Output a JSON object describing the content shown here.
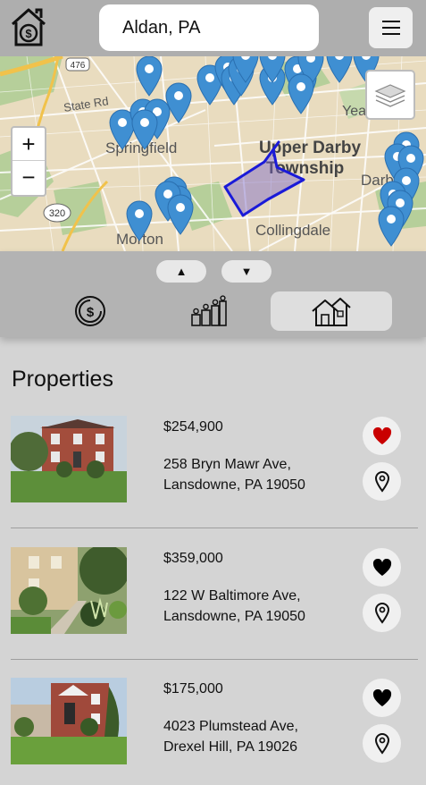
{
  "header": {
    "search_value": "Aldan, PA",
    "menu_icon": "hamburger-icon",
    "logo_icon": "house-dollar-icon"
  },
  "map": {
    "labels": {
      "road_476": "476",
      "state_rd": "State Rd",
      "springfield": "Springfield",
      "upper_darby": "Upper Darby",
      "township": "Township",
      "darby": "Darby",
      "yea": "Yea",
      "collingdale": "Collingdale",
      "morton": "Morton",
      "road_320": "320"
    },
    "zoom_in": "+",
    "zoom_out": "−",
    "layers_icon": "layers-icon",
    "marker_color": "#3f8fd2",
    "boundary_color": "#1a1ad8"
  },
  "panel": {
    "up_arrow": "▲",
    "down_arrow": "▼",
    "tabs": [
      {
        "icon": "dollar-circle-icon",
        "active": false
      },
      {
        "icon": "bar-chart-people-icon",
        "active": false
      },
      {
        "icon": "houses-icon",
        "active": true
      }
    ]
  },
  "listings_title": "Properties",
  "listings": [
    {
      "price": "$254,900",
      "address_line1": "258 Bryn Mawr Ave,",
      "address_line2": "Lansdowne, PA 19050",
      "favorited": true
    },
    {
      "price": "$359,000",
      "address_line1": "122 W Baltimore Ave,",
      "address_line2": "Lansdowne, PA 19050",
      "favorited": false
    },
    {
      "price": "$175,000",
      "address_line1": "4023 Plumstead Ave,",
      "address_line2": "Drexel Hill, PA 19026",
      "favorited": false
    }
  ],
  "colors": {
    "favorite_active": "#c90000",
    "favorite_inactive": "#000000"
  }
}
